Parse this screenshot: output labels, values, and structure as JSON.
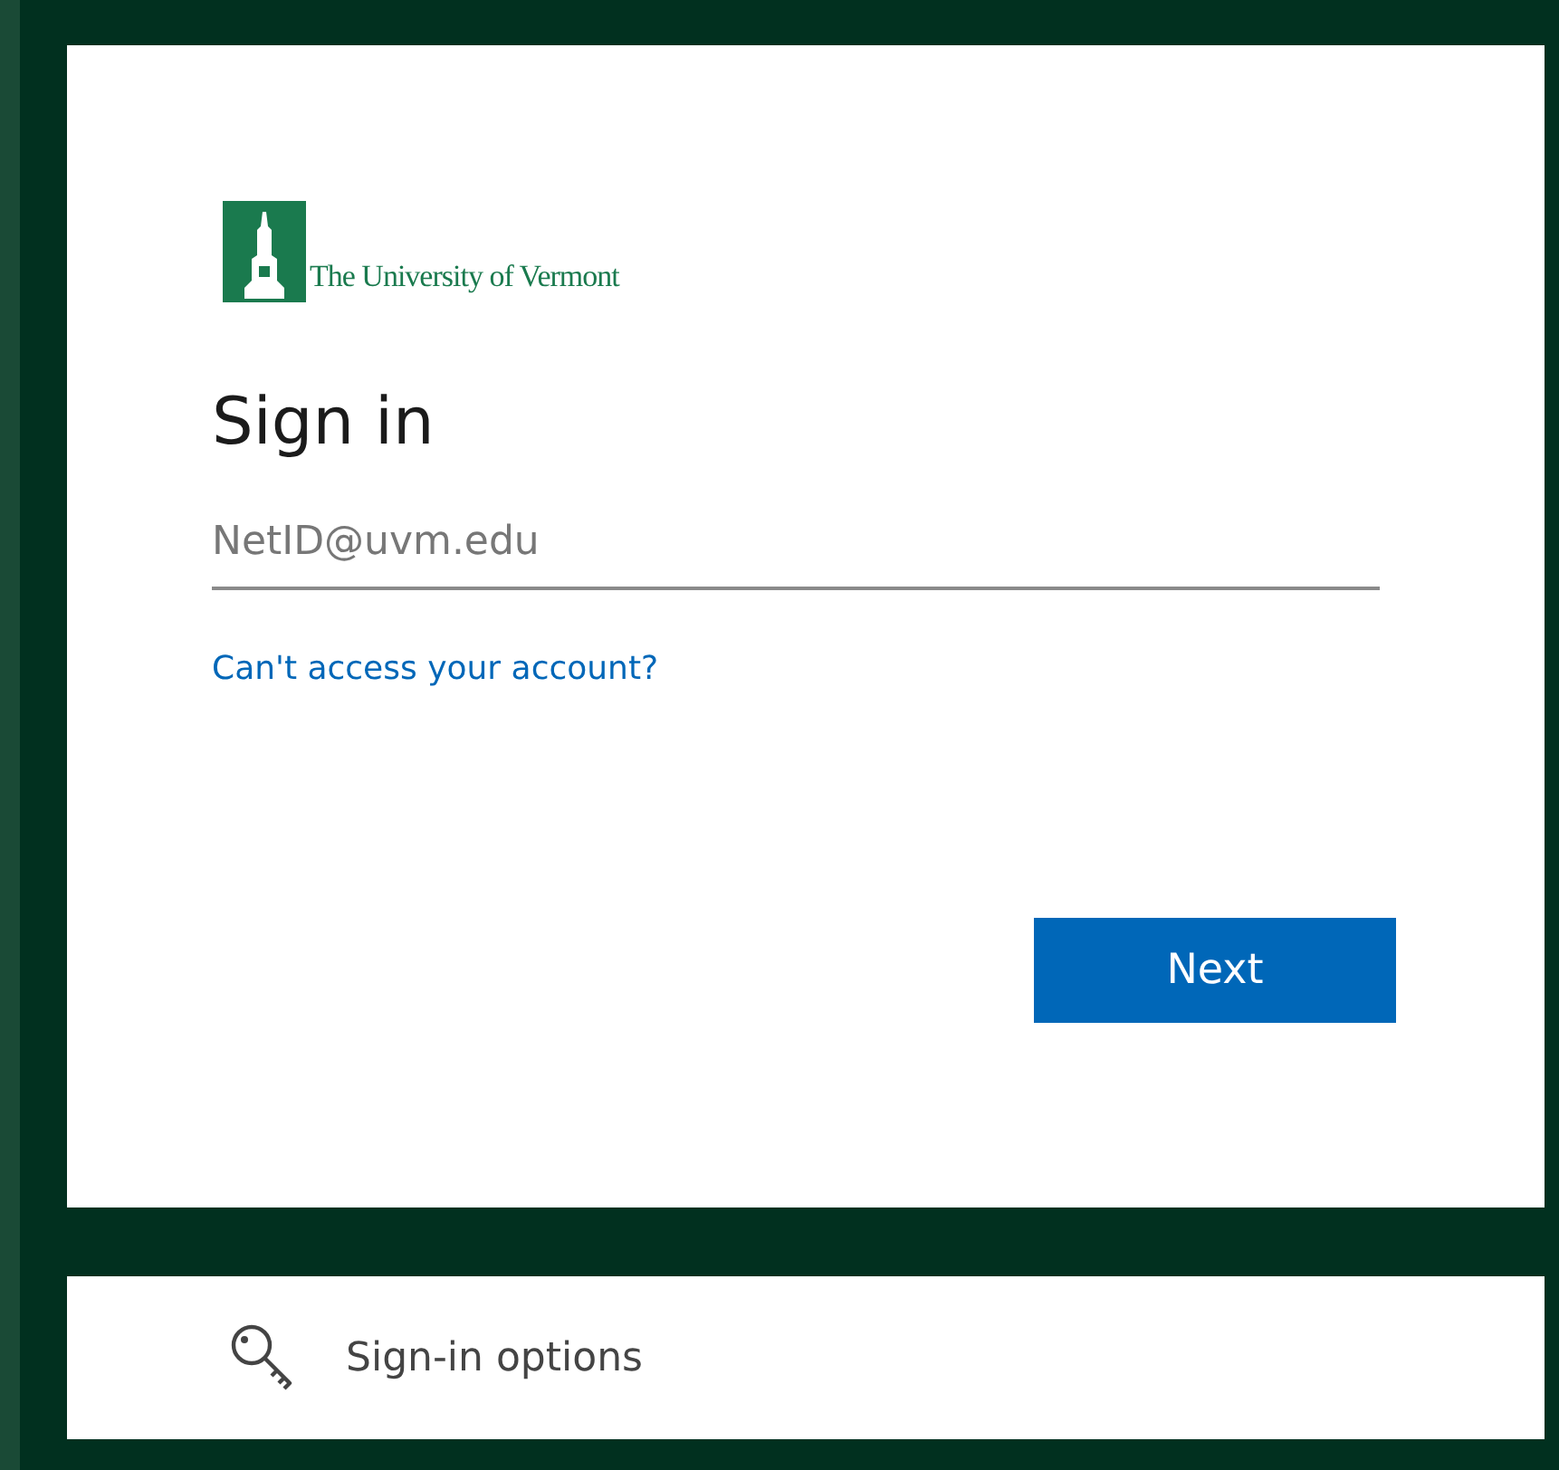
{
  "logo": {
    "text": "The University of Vermont"
  },
  "title": "Sign in",
  "email_field": {
    "placeholder": "NetID@uvm.edu"
  },
  "help_link": "Can't access your account?",
  "next_button": "Next",
  "options": {
    "label": "Sign-in options"
  }
}
